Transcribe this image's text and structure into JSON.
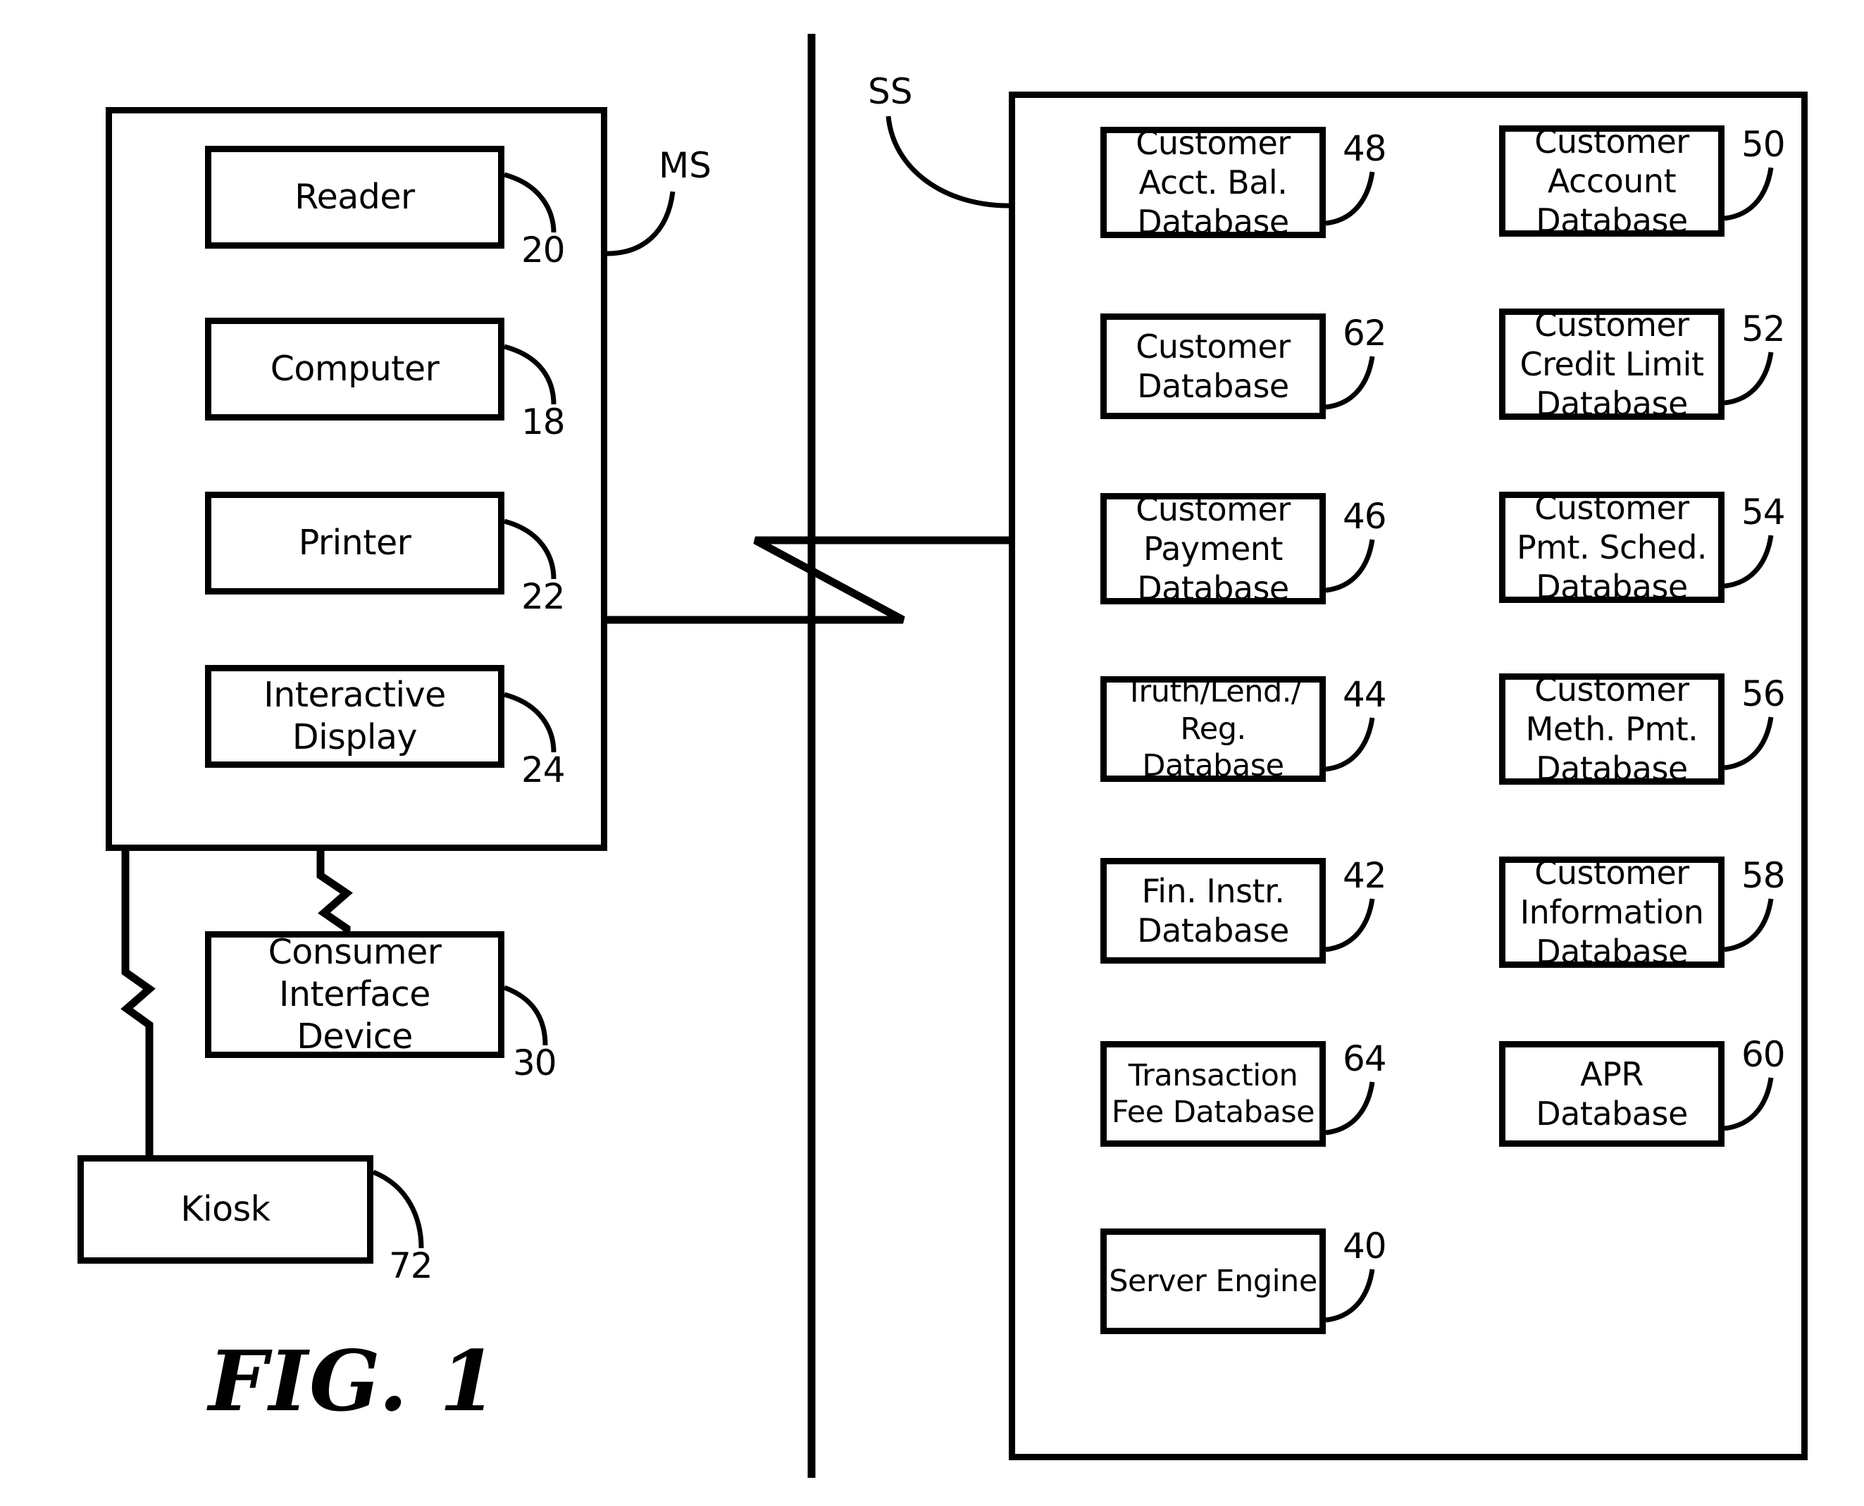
{
  "figure": {
    "caption": "FIG. 1",
    "system_labels": [
      {
        "id": "ms",
        "text": "MS"
      },
      {
        "id": "ss",
        "text": "SS"
      }
    ]
  },
  "merchant_system": {
    "label": "MS",
    "ref": "",
    "components": [
      {
        "name": "reader",
        "label": "Reader",
        "ref": "20"
      },
      {
        "name": "computer",
        "label": "Computer",
        "ref": "18"
      },
      {
        "name": "printer",
        "label": "Printer",
        "ref": "22"
      },
      {
        "name": "interactive-display",
        "label": "Interactive\nDisplay",
        "ref": "24"
      }
    ],
    "external": [
      {
        "name": "consumer-interface-device",
        "label": "Consumer\nInterface\nDevice",
        "ref": "30"
      },
      {
        "name": "kiosk",
        "label": "Kiosk",
        "ref": "72"
      }
    ]
  },
  "server_system": {
    "label": "SS",
    "left_column": [
      {
        "name": "customer-acct-bal-database",
        "label": "Customer\nAcct. Bal.\nDatabase",
        "ref": "48"
      },
      {
        "name": "customer-database",
        "label": "Customer\nDatabase",
        "ref": "62"
      },
      {
        "name": "customer-payment-database",
        "label": "Customer\nPayment\nDatabase",
        "ref": "46"
      },
      {
        "name": "truth-lend-reg-database",
        "label": "Truth/Lend./\nReg. Database",
        "ref": "44"
      },
      {
        "name": "fin-instr-database",
        "label": "Fin. Instr.\nDatabase",
        "ref": "42"
      },
      {
        "name": "transaction-fee-database",
        "label": "Transaction\nFee Database",
        "ref": "64"
      },
      {
        "name": "server-engine",
        "label": "Server Engine",
        "ref": "40"
      }
    ],
    "right_column": [
      {
        "name": "customer-account-database",
        "label": "Customer\nAccount\nDatabase",
        "ref": "50"
      },
      {
        "name": "customer-credit-limit-database",
        "label": "Customer\nCredit Limit\nDatabase",
        "ref": "52"
      },
      {
        "name": "customer-pmt-sched-database",
        "label": "Customer\nPmt. Sched.\nDatabase",
        "ref": "54"
      },
      {
        "name": "customer-meth-pmt-database",
        "label": "Customer\nMeth. Pmt.\nDatabase",
        "ref": "56"
      },
      {
        "name": "customer-information-database",
        "label": "Customer\nInformation\nDatabase",
        "ref": "58"
      },
      {
        "name": "apr-database",
        "label": "APR Database",
        "ref": "60"
      }
    ]
  },
  "colors": {
    "ink": "#000000",
    "paper": "#ffffff"
  }
}
